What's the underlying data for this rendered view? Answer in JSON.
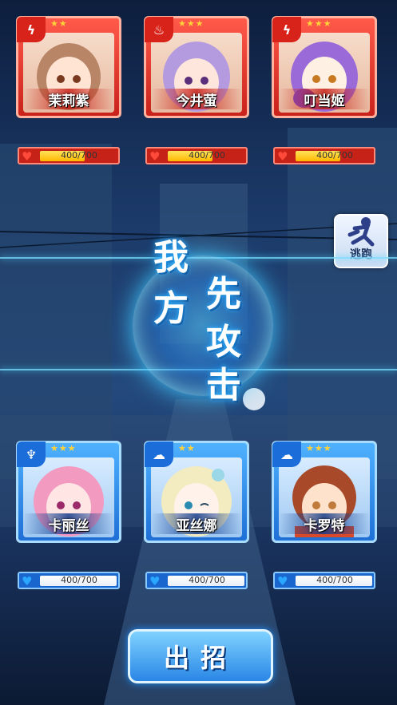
{
  "enemy_team": [
    {
      "name": "茉莉紫",
      "stars": "★★",
      "element": "lightning-icon",
      "hp": "400/700",
      "hp_fraction": 0.57
    },
    {
      "name": "今井萤",
      "stars": "★★★",
      "element": "fire-crest-icon",
      "hp": "400/700",
      "hp_fraction": 0.57
    },
    {
      "name": "叮当姬",
      "stars": "★★★",
      "element": "lightning-icon",
      "hp": "400/700",
      "hp_fraction": 0.57
    }
  ],
  "ally_team": [
    {
      "name": "卡丽丝",
      "stars": "★★★",
      "element": "water-crest-icon",
      "hp": "400/700",
      "hp_fraction": 0.57
    },
    {
      "name": "亚丝娜",
      "stars": "★★",
      "element": "cloud-crest-icon",
      "hp": "400/700",
      "hp_fraction": 0.57
    },
    {
      "name": "卡罗特",
      "stars": "★★★",
      "element": "cloud-crest-icon",
      "hp": "400/700",
      "hp_fraction": 0.57
    }
  ],
  "turn_banner": {
    "line1": "我",
    "line2": "方",
    "line3": "先",
    "line4": "攻",
    "line5": "击"
  },
  "flee_button": {
    "label": "逃跑",
    "icon": "running-figure-icon"
  },
  "attack_button": {
    "label": "出招"
  },
  "colors": {
    "enemy": "#d8231b",
    "ally": "#1b6ed9",
    "hp_enemy_fill": "#ffd23a",
    "glow": "#3fc8ff"
  }
}
